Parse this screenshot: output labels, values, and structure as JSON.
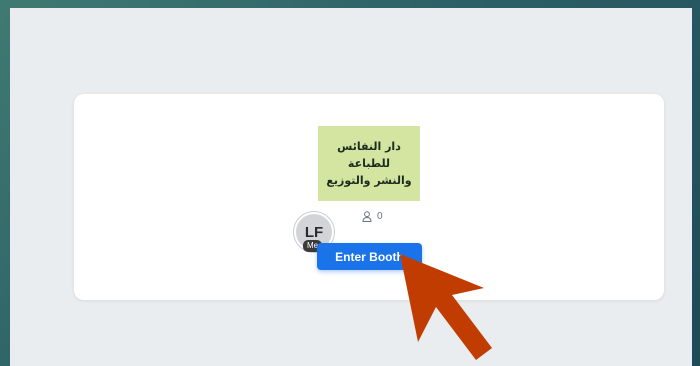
{
  "booth": {
    "logo_text": "دار النفائس للطباعة\nوالنشر والتوزيع",
    "visitor_count": "0",
    "enter_label": "Enter Booth"
  },
  "user": {
    "initials": "LF",
    "me_label": "Me"
  },
  "icons": {
    "visitor": "user-icon",
    "annotation": "pointer-arrow-icon"
  },
  "colors": {
    "button": "#1a73e8",
    "logo_bg": "#d3e5a0",
    "arrow": "#c13c00",
    "card_bg": "#ffffff",
    "panel_bg": "#eaedf0"
  }
}
